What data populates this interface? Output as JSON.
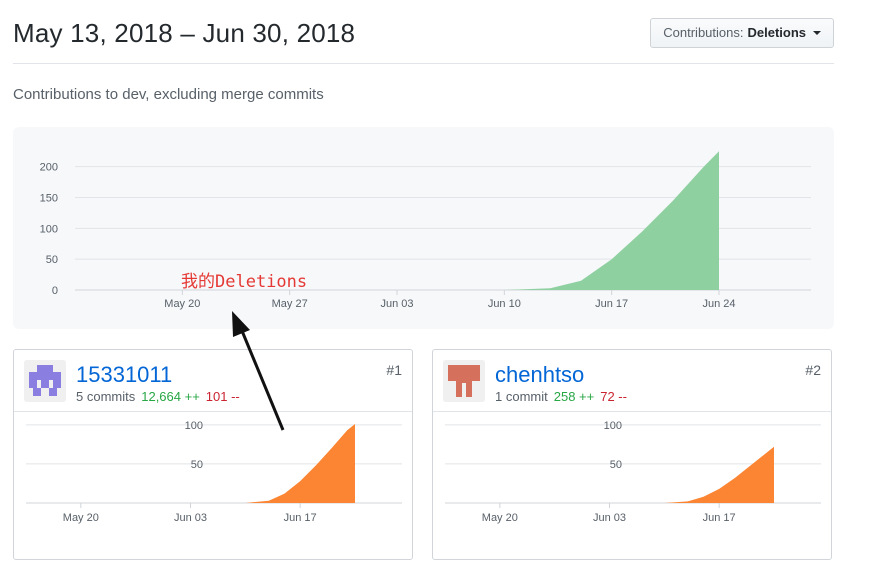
{
  "header": {
    "date_range": "May 13, 2018 – Jun 30, 2018",
    "contrib_button": {
      "prefix": "Contributions:",
      "value": "Deletions"
    }
  },
  "subtitle": "Contributions to dev, excluding merge commits",
  "annotation": "我的Deletions",
  "colors": {
    "main_area": "#8fd0a0",
    "card_area": "#fb8532",
    "link": "#0366d6",
    "additions": "#28a745",
    "deletions": "#cb2431"
  },
  "chart_data": [
    {
      "type": "area",
      "title": "",
      "ylim": [
        0,
        240
      ],
      "yticks": [
        0,
        50,
        100,
        150,
        200
      ],
      "xlim": [
        "2018-05-13",
        "2018-06-30"
      ],
      "xtick_labels": [
        "May 20",
        "May 27",
        "Jun 03",
        "Jun 10",
        "Jun 17",
        "Jun 24"
      ],
      "xtick_dates": [
        "2018-05-20",
        "2018-05-27",
        "2018-06-03",
        "2018-06-10",
        "2018-06-17",
        "2018-06-24"
      ],
      "series": [
        {
          "x": [
            "2018-05-20",
            "2018-05-27",
            "2018-06-03",
            "2018-06-10",
            "2018-06-13",
            "2018-06-15",
            "2018-06-17",
            "2018-06-19",
            "2018-06-21",
            "2018-06-23",
            "2018-06-24"
          ],
          "values": [
            0,
            0,
            0,
            0,
            3,
            15,
            50,
            95,
            145,
            200,
            225
          ]
        }
      ]
    },
    {
      "type": "area",
      "title": "",
      "ylim": [
        0,
        110
      ],
      "yticks": [
        50,
        100
      ],
      "xlim": [
        "2018-05-13",
        "2018-06-30"
      ],
      "xtick_labels": [
        "May 20",
        "Jun 03",
        "Jun 17"
      ],
      "xtick_dates": [
        "2018-05-20",
        "2018-06-03",
        "2018-06-17"
      ],
      "series": [
        {
          "x": [
            "2018-06-10",
            "2018-06-13",
            "2018-06-15",
            "2018-06-17",
            "2018-06-19",
            "2018-06-21",
            "2018-06-23",
            "2018-06-24"
          ],
          "values": [
            0,
            3,
            12,
            28,
            48,
            70,
            93,
            101
          ]
        }
      ]
    },
    {
      "type": "area",
      "title": "",
      "ylim": [
        0,
        110
      ],
      "yticks": [
        50,
        100
      ],
      "xlim": [
        "2018-05-13",
        "2018-06-30"
      ],
      "xtick_labels": [
        "May 20",
        "Jun 03",
        "Jun 17"
      ],
      "xtick_dates": [
        "2018-05-20",
        "2018-06-03",
        "2018-06-17"
      ],
      "series": [
        {
          "x": [
            "2018-06-10",
            "2018-06-13",
            "2018-06-15",
            "2018-06-17",
            "2018-06-19",
            "2018-06-21",
            "2018-06-23",
            "2018-06-24"
          ],
          "values": [
            0,
            2,
            8,
            18,
            32,
            48,
            64,
            72
          ]
        }
      ]
    }
  ],
  "contributors": [
    {
      "rank": "#1",
      "username": "15331011",
      "commits": "5 commits",
      "additions": "12,664 ++",
      "deletions": "101 --",
      "avatar_icon": "identicon-purple"
    },
    {
      "rank": "#2",
      "username": "chenhtso",
      "commits": "1 commit",
      "additions": "258 ++",
      "deletions": "72 --",
      "avatar_icon": "identicon-red"
    }
  ]
}
